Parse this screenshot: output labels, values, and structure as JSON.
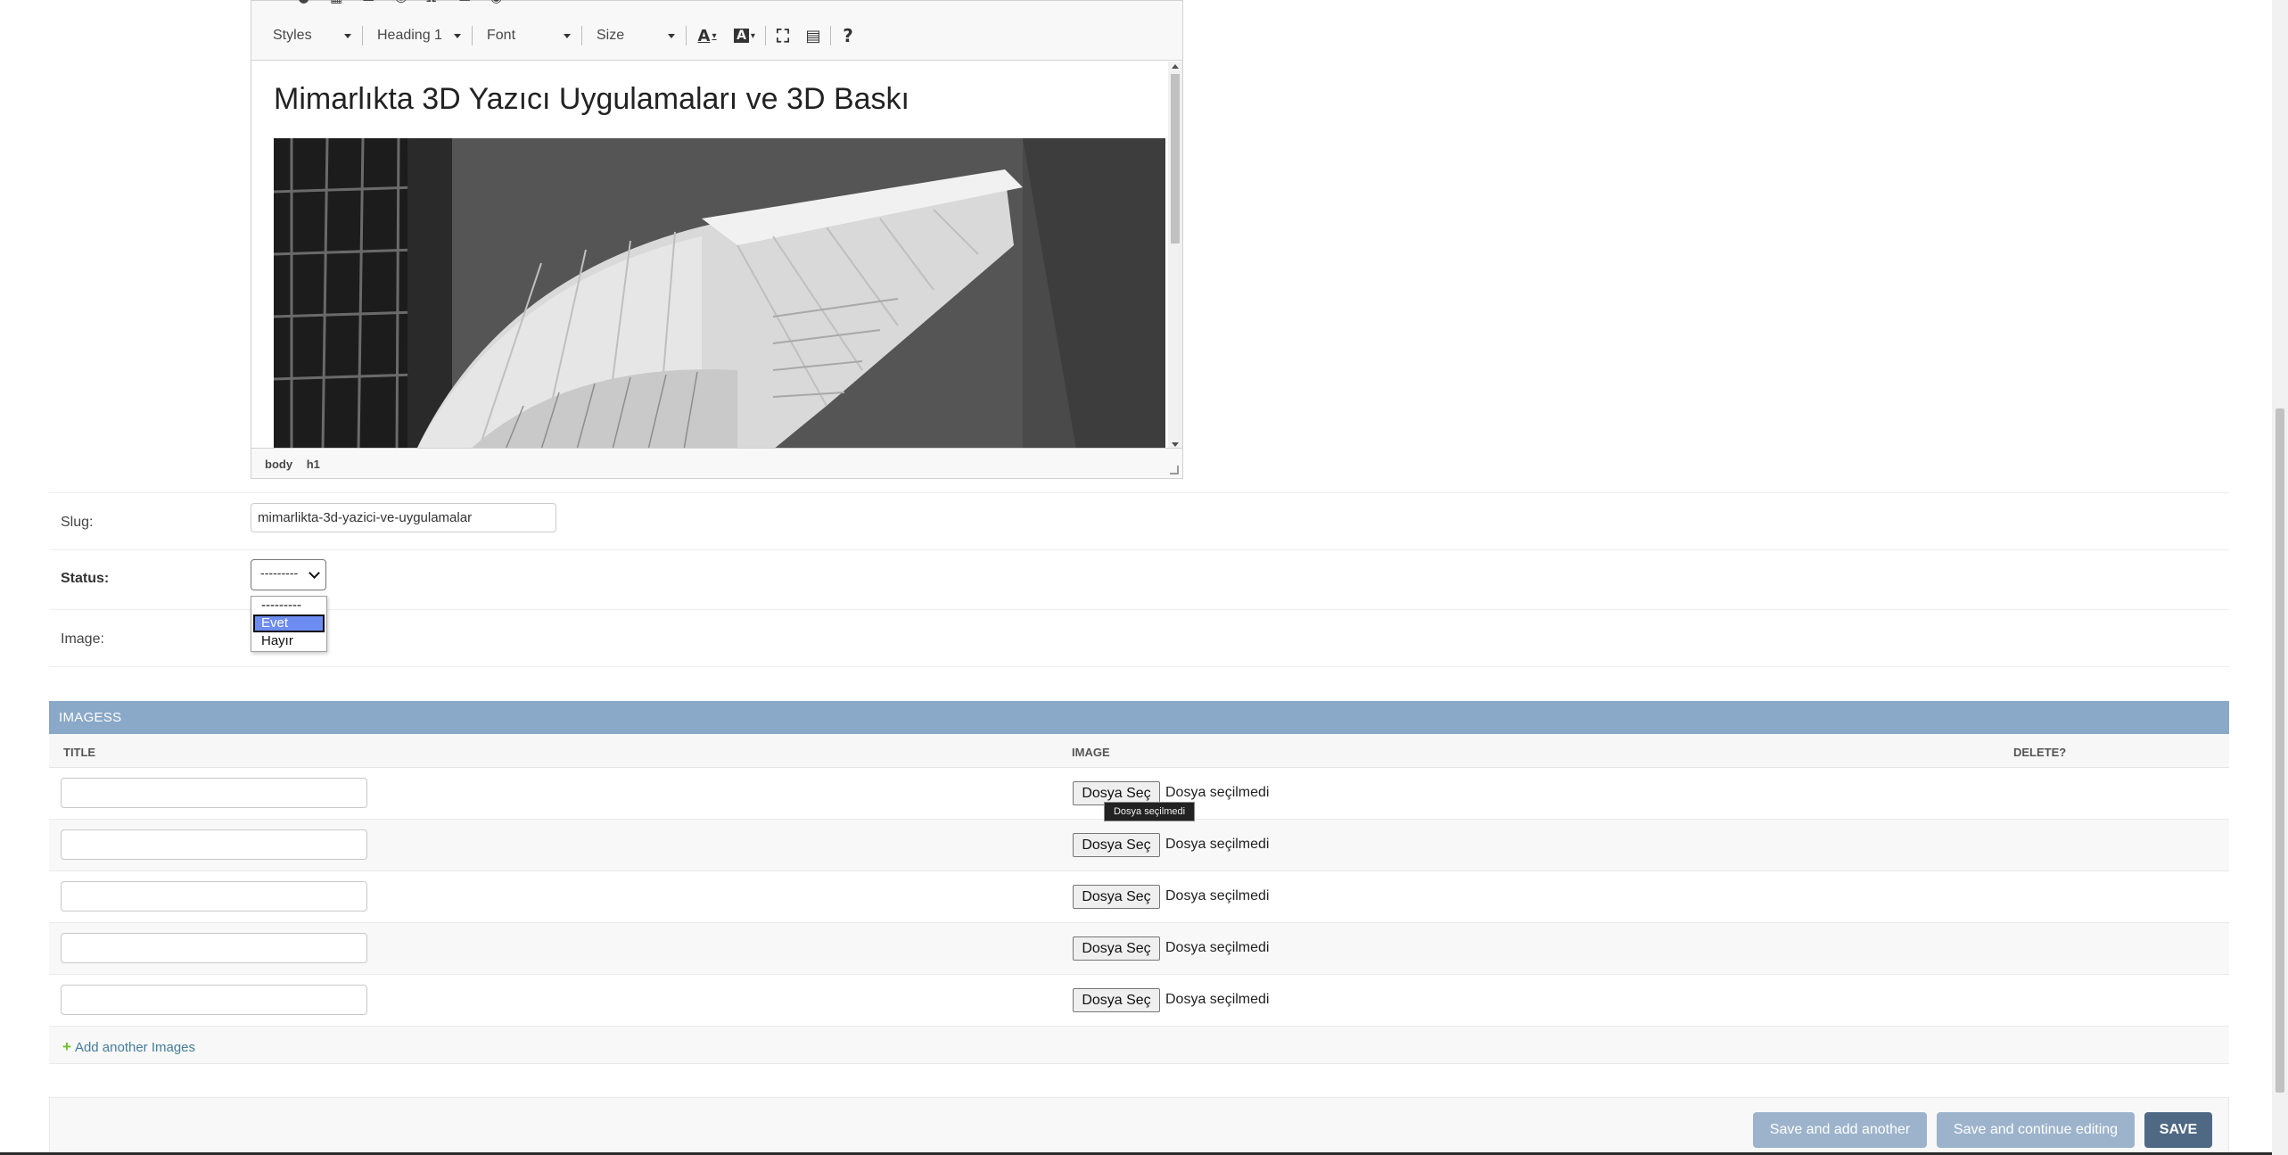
{
  "editor": {
    "toolbar": {
      "icons": [
        "image-icon",
        "flash-icon",
        "table-icon",
        "horizontal-rule-icon",
        "smiley-icon",
        "special-char-icon",
        "page-break-icon",
        "iframe-icon"
      ],
      "styles_label": "Styles",
      "format_label": "Heading 1",
      "font_label": "Font",
      "size_label": "Size",
      "text_color_label": "A",
      "bg_color_label": "A",
      "help_label": "?"
    },
    "content_heading": "Mimarlıkta 3D Yazıcı Uygulamaları ve 3D Baskı",
    "path": [
      "body",
      "h1"
    ]
  },
  "form": {
    "slug_label": "Slug:",
    "slug_value": "mimarlikta-3d-yazici-ve-uygulamalar",
    "status_label": "Status:",
    "status_value": "---------",
    "status_options": [
      "---------",
      "Evet",
      "Hayır"
    ],
    "status_highlighted": "Evet",
    "image_label": "Image:"
  },
  "inline": {
    "title": "IMAGESS",
    "col_title": "TITLE",
    "col_image": "IMAGE",
    "col_delete": "DELETE?",
    "file_button": "Dosya Seç",
    "file_status": "Dosya seçilmedi",
    "tooltip": "Dosya seçilmedi",
    "rows": 5,
    "add_label": "Add another Images"
  },
  "submit": {
    "save_add": "Save and add another",
    "save_continue": "Save and continue editing",
    "save": "SAVE"
  }
}
